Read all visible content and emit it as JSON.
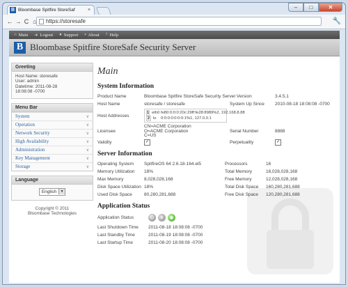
{
  "browser": {
    "tab_title": "Bloombase Spitfire StoreSaf",
    "tab_close": "×",
    "url": "https://storesafe",
    "controls": {
      "minimize": "–",
      "maximize": "□",
      "close": "✕"
    }
  },
  "app_menu": [
    {
      "label": "Main",
      "icon": "home-icon"
    },
    {
      "label": "Logout",
      "icon": "logout-icon"
    },
    {
      "label": "Support",
      "icon": "support-icon"
    },
    {
      "label": "About",
      "icon": "about-icon"
    },
    {
      "label": "Help",
      "icon": "help-icon"
    }
  ],
  "app_title": "Bloombase Spitfire StoreSafe Security Server",
  "logo_letter": "B",
  "greeting": {
    "title": "Greeting",
    "host_name": "Host Name: storesafe",
    "user": "User: admin",
    "datetime_line1": "Datetime: 2011-08-28",
    "datetime_line2": "18:08:08 -0700"
  },
  "menu_bar": {
    "title": "Menu Bar",
    "items": [
      "System",
      "Operation",
      "Network Security",
      "High Availability",
      "Administration",
      "Key Management",
      "Storage"
    ]
  },
  "language": {
    "title": "Language",
    "selected": "English"
  },
  "copyright": {
    "line1": "Copyright © 2011",
    "line2": "Bloombase Technologies"
  },
  "main": {
    "title": "Main",
    "system_info": {
      "title": "System Information",
      "product_name_label": "Product Name",
      "product_name": "Bloombase Spitfire StoreSafe Security Server",
      "version_label": "Version",
      "version": "3.4.5.1",
      "host_name_label": "Host Name",
      "host_name": "storesafe / storesafe",
      "system_up_since_label": "System Up Since",
      "system_up_since": "2010-08-18 18:08:08 -0700",
      "host_addresses_label": "Host Addresses",
      "addresses": [
        {
          "index": "1",
          "text": "eth0 fe80:0:0:0:20c:29ff:fe28:8989%2, 192.168.8.88"
        },
        {
          "index": "2",
          "text": "lo    0:0:0:0:0:0:0:1%1, 127.0.0.1"
        }
      ],
      "licensee_label": "Licensee",
      "licensee_line1": "CN=ACME Corporation",
      "licensee_line2": "O=ACME Corporation",
      "licensee_line3": "C=US",
      "serial_label": "Serial Number",
      "serial": "8888",
      "validity_label": "Validity",
      "perpetuality_label": "Perpetuality",
      "check": "✓"
    },
    "server_info": {
      "title": "Server Information",
      "rows": [
        {
          "l1": "Operating System",
          "v1": "SpitfireOS 64 2.6.18-164.el5",
          "l2": "Processors",
          "v2": "16"
        },
        {
          "l1": "Memory Utilization",
          "v1": "18%",
          "l2": "Total Memory",
          "v2": "16,028,028,168"
        },
        {
          "l1": "Max Memory",
          "v1": "8,028,028,168",
          "l2": "Free Memory",
          "v2": "12,028,028,168"
        },
        {
          "l1": "Disk Space Utilization",
          "v1": "18%",
          "l2": "Total Disk Space",
          "v2": "160,280,281,688"
        },
        {
          "l1": "Used Disk Space",
          "v1": "80,280,281,688",
          "l2": "Free Disk Space",
          "v2": "120,280,281,688"
        }
      ]
    },
    "app_status": {
      "title": "Application Status",
      "status_label": "Application Status",
      "rows": [
        {
          "label": "Last Shutdown Time",
          "value": "2011-08-18 18:08:08 -0700"
        },
        {
          "label": "Last Standby Time",
          "value": "2011-08-19 18:08:08 -0700"
        },
        {
          "label": "Last Startup Time",
          "value": "2011-08-20 18:08:08 -0700"
        }
      ]
    }
  }
}
